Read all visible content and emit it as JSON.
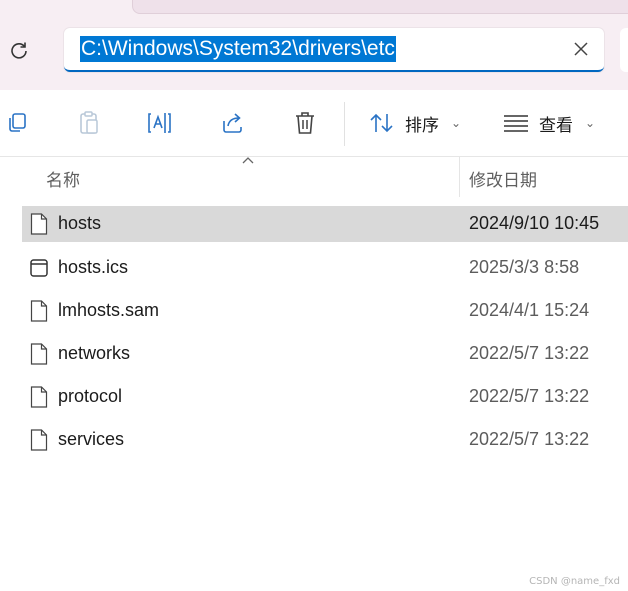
{
  "address_bar": {
    "path": "C:\\Windows\\System32\\drivers\\etc"
  },
  "toolbar": {
    "sort_label": "排序",
    "view_label": "查看"
  },
  "columns": {
    "name": "名称",
    "date_modified": "修改日期"
  },
  "files": [
    {
      "name": "hosts",
      "date": "2024/9/10 10:45",
      "icon": "file-icon",
      "selected": true
    },
    {
      "name": "hosts.ics",
      "date": "2025/3/3 8:58",
      "icon": "window-file-icon",
      "selected": false
    },
    {
      "name": "lmhosts.sam",
      "date": "2024/4/1 15:24",
      "icon": "file-icon",
      "selected": false
    },
    {
      "name": "networks",
      "date": "2022/5/7 13:22",
      "icon": "file-icon",
      "selected": false
    },
    {
      "name": "protocol",
      "date": "2022/5/7 13:22",
      "icon": "file-icon",
      "selected": false
    },
    {
      "name": "services",
      "date": "2022/5/7 13:22",
      "icon": "file-icon",
      "selected": false
    }
  ],
  "watermark": "CSDN @name_fxd",
  "colors": {
    "accent": "#0078d4",
    "selection": "#d9d9d9",
    "header_bg": "#f7eef3"
  }
}
